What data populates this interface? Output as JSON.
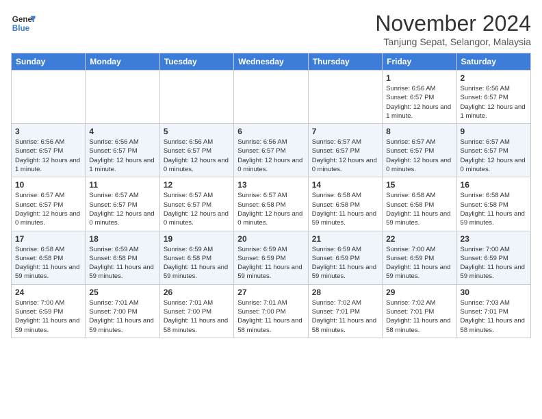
{
  "header": {
    "logo_line1": "General",
    "logo_line2": "Blue",
    "month": "November 2024",
    "location": "Tanjung Sepat, Selangor, Malaysia"
  },
  "weekdays": [
    "Sunday",
    "Monday",
    "Tuesday",
    "Wednesday",
    "Thursday",
    "Friday",
    "Saturday"
  ],
  "weeks": [
    [
      {
        "day": "",
        "info": ""
      },
      {
        "day": "",
        "info": ""
      },
      {
        "day": "",
        "info": ""
      },
      {
        "day": "",
        "info": ""
      },
      {
        "day": "",
        "info": ""
      },
      {
        "day": "1",
        "info": "Sunrise: 6:56 AM\nSunset: 6:57 PM\nDaylight: 12 hours and 1 minute."
      },
      {
        "day": "2",
        "info": "Sunrise: 6:56 AM\nSunset: 6:57 PM\nDaylight: 12 hours and 1 minute."
      }
    ],
    [
      {
        "day": "3",
        "info": "Sunrise: 6:56 AM\nSunset: 6:57 PM\nDaylight: 12 hours and 1 minute."
      },
      {
        "day": "4",
        "info": "Sunrise: 6:56 AM\nSunset: 6:57 PM\nDaylight: 12 hours and 1 minute."
      },
      {
        "day": "5",
        "info": "Sunrise: 6:56 AM\nSunset: 6:57 PM\nDaylight: 12 hours and 0 minutes."
      },
      {
        "day": "6",
        "info": "Sunrise: 6:56 AM\nSunset: 6:57 PM\nDaylight: 12 hours and 0 minutes."
      },
      {
        "day": "7",
        "info": "Sunrise: 6:57 AM\nSunset: 6:57 PM\nDaylight: 12 hours and 0 minutes."
      },
      {
        "day": "8",
        "info": "Sunrise: 6:57 AM\nSunset: 6:57 PM\nDaylight: 12 hours and 0 minutes."
      },
      {
        "day": "9",
        "info": "Sunrise: 6:57 AM\nSunset: 6:57 PM\nDaylight: 12 hours and 0 minutes."
      }
    ],
    [
      {
        "day": "10",
        "info": "Sunrise: 6:57 AM\nSunset: 6:57 PM\nDaylight: 12 hours and 0 minutes."
      },
      {
        "day": "11",
        "info": "Sunrise: 6:57 AM\nSunset: 6:57 PM\nDaylight: 12 hours and 0 minutes."
      },
      {
        "day": "12",
        "info": "Sunrise: 6:57 AM\nSunset: 6:57 PM\nDaylight: 12 hours and 0 minutes."
      },
      {
        "day": "13",
        "info": "Sunrise: 6:57 AM\nSunset: 6:58 PM\nDaylight: 12 hours and 0 minutes."
      },
      {
        "day": "14",
        "info": "Sunrise: 6:58 AM\nSunset: 6:58 PM\nDaylight: 11 hours and 59 minutes."
      },
      {
        "day": "15",
        "info": "Sunrise: 6:58 AM\nSunset: 6:58 PM\nDaylight: 11 hours and 59 minutes."
      },
      {
        "day": "16",
        "info": "Sunrise: 6:58 AM\nSunset: 6:58 PM\nDaylight: 11 hours and 59 minutes."
      }
    ],
    [
      {
        "day": "17",
        "info": "Sunrise: 6:58 AM\nSunset: 6:58 PM\nDaylight: 11 hours and 59 minutes."
      },
      {
        "day": "18",
        "info": "Sunrise: 6:59 AM\nSunset: 6:58 PM\nDaylight: 11 hours and 59 minutes."
      },
      {
        "day": "19",
        "info": "Sunrise: 6:59 AM\nSunset: 6:58 PM\nDaylight: 11 hours and 59 minutes."
      },
      {
        "day": "20",
        "info": "Sunrise: 6:59 AM\nSunset: 6:59 PM\nDaylight: 11 hours and 59 minutes."
      },
      {
        "day": "21",
        "info": "Sunrise: 6:59 AM\nSunset: 6:59 PM\nDaylight: 11 hours and 59 minutes."
      },
      {
        "day": "22",
        "info": "Sunrise: 7:00 AM\nSunset: 6:59 PM\nDaylight: 11 hours and 59 minutes."
      },
      {
        "day": "23",
        "info": "Sunrise: 7:00 AM\nSunset: 6:59 PM\nDaylight: 11 hours and 59 minutes."
      }
    ],
    [
      {
        "day": "24",
        "info": "Sunrise: 7:00 AM\nSunset: 6:59 PM\nDaylight: 11 hours and 59 minutes."
      },
      {
        "day": "25",
        "info": "Sunrise: 7:01 AM\nSunset: 7:00 PM\nDaylight: 11 hours and 59 minutes."
      },
      {
        "day": "26",
        "info": "Sunrise: 7:01 AM\nSunset: 7:00 PM\nDaylight: 11 hours and 58 minutes."
      },
      {
        "day": "27",
        "info": "Sunrise: 7:01 AM\nSunset: 7:00 PM\nDaylight: 11 hours and 58 minutes."
      },
      {
        "day": "28",
        "info": "Sunrise: 7:02 AM\nSunset: 7:01 PM\nDaylight: 11 hours and 58 minutes."
      },
      {
        "day": "29",
        "info": "Sunrise: 7:02 AM\nSunset: 7:01 PM\nDaylight: 11 hours and 58 minutes."
      },
      {
        "day": "30",
        "info": "Sunrise: 7:03 AM\nSunset: 7:01 PM\nDaylight: 11 hours and 58 minutes."
      }
    ]
  ]
}
